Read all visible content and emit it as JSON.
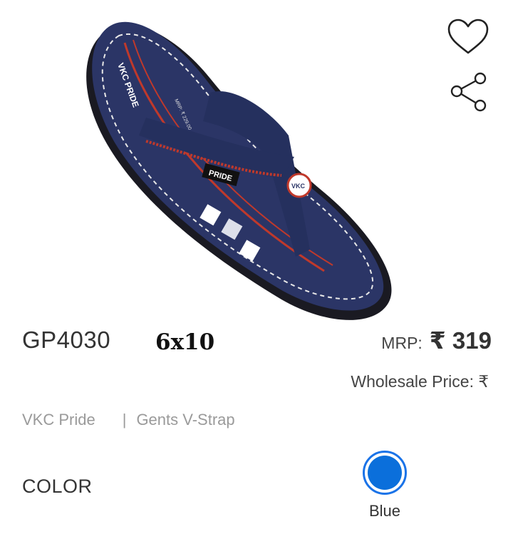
{
  "product": {
    "code": "GP4030",
    "pack": "6x10",
    "brand": "VKC Pride",
    "separator": "|",
    "category": "Gents V-Strap",
    "image_icon": "sandal-product-image",
    "image_logo_text": "VKC PRIDE",
    "image_strap_text": "PRIDE",
    "image_badge_text": "VKC",
    "image_mrp_text": "MRP: ₹ 229.00"
  },
  "pricing": {
    "mrp_label": "MRP:",
    "mrp_value": "₹ 319",
    "wholesale_text": "Wholesale Price: ₹"
  },
  "actions": {
    "wishlist_icon": "heart-icon",
    "share_icon": "share-icon"
  },
  "color": {
    "label": "COLOR",
    "options": [
      {
        "name": "Blue",
        "hex": "#0b6fdb",
        "selected": true
      }
    ],
    "selected_ring_hex": "#1a73e8"
  }
}
